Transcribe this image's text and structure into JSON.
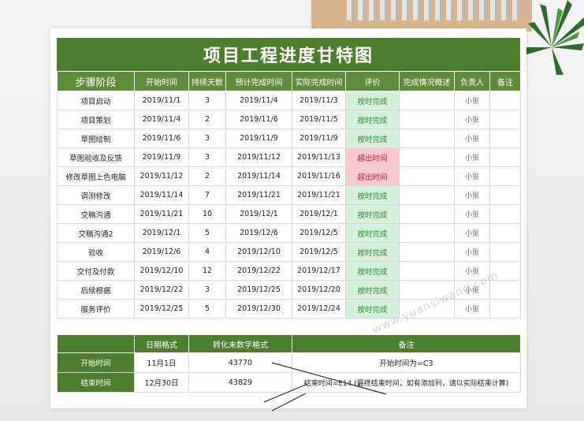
{
  "title": "项目工程进度甘特图",
  "headers": [
    "步骤阶段",
    "开始时间",
    "持续天数",
    "预计完成时间",
    "实际完成时间",
    "评价",
    "完成情况概述",
    "负责人",
    "备注"
  ],
  "rows": [
    {
      "step": "项目启动",
      "start": "2019/11/1",
      "days": "3",
      "planned": "2019/11/4",
      "actual": "2019/11/3",
      "eval": "按时完成",
      "status": "ok",
      "summary": "",
      "owner": "小张",
      "note": ""
    },
    {
      "step": "项目策划",
      "start": "2019/11/4",
      "days": "2",
      "planned": "2019/11/6",
      "actual": "2019/11/5",
      "eval": "按时完成",
      "status": "ok",
      "summary": "",
      "owner": "小张",
      "note": ""
    },
    {
      "step": "草图绘制",
      "start": "2019/11/6",
      "days": "3",
      "planned": "2019/11/9",
      "actual": "2019/11/9",
      "eval": "按时完成",
      "status": "ok",
      "summary": "",
      "owner": "小张",
      "note": ""
    },
    {
      "step": "草图验收及反馈",
      "start": "2019/11/9",
      "days": "3",
      "planned": "2019/11/12",
      "actual": "2019/11/13",
      "eval": "超出时间",
      "status": "late",
      "summary": "",
      "owner": "小张",
      "note": ""
    },
    {
      "step": "修改草图上色电脑",
      "start": "2019/11/12",
      "days": "2",
      "planned": "2019/11/14",
      "actual": "2019/11/16",
      "eval": "超出时间",
      "status": "late",
      "summary": "",
      "owner": "小张",
      "note": ""
    },
    {
      "step": "调测修改",
      "start": "2019/11/14",
      "days": "7",
      "planned": "2019/11/21",
      "actual": "2019/11/21",
      "eval": "按时完成",
      "status": "ok",
      "summary": "",
      "owner": "小张",
      "note": ""
    },
    {
      "step": "交稿沟通",
      "start": "2019/11/21",
      "days": "10",
      "planned": "2019/12/1",
      "actual": "2019/12/1",
      "eval": "按时完成",
      "status": "ok",
      "summary": "",
      "owner": "小张",
      "note": ""
    },
    {
      "step": "交稿沟通2",
      "start": "2019/12/1",
      "days": "5",
      "planned": "2019/12/6",
      "actual": "2019/12/5",
      "eval": "按时完成",
      "status": "ok",
      "summary": "",
      "owner": "小张",
      "note": ""
    },
    {
      "step": "验收",
      "start": "2019/12/6",
      "days": "4",
      "planned": "2019/12/10",
      "actual": "2019/12/5",
      "eval": "按时完成",
      "status": "ok",
      "summary": "",
      "owner": "小张",
      "note": ""
    },
    {
      "step": "交付及付款",
      "start": "2019/12/10",
      "days": "12",
      "planned": "2019/12/22",
      "actual": "2019/12/17",
      "eval": "按时完成",
      "status": "ok",
      "summary": "",
      "owner": "小张",
      "note": ""
    },
    {
      "step": "后续根据",
      "start": "2019/12/22",
      "days": "3",
      "planned": "2019/12/25",
      "actual": "2019/12/20",
      "eval": "按时完成",
      "status": "ok",
      "summary": "",
      "owner": "小张",
      "note": ""
    },
    {
      "step": "服务评价",
      "start": "2019/12/25",
      "days": "5",
      "planned": "2019/12/30",
      "actual": "2019/12/24",
      "eval": "按时完成",
      "status": "ok",
      "summary": "",
      "owner": "小张",
      "note": ""
    }
  ],
  "helper": {
    "headers": [
      "",
      "日期格式",
      "转化未数字格式",
      "备注"
    ],
    "rows": [
      {
        "label": "开始时间",
        "date": "11月1日",
        "num": "43770",
        "note": "开始时间为=C3"
      },
      {
        "label": "结束时间",
        "date": "12月30日",
        "num": "43829",
        "note": "结束时间=E14 (最终结束时间，如有添加列，请以实际结束计算)"
      }
    ]
  },
  "watermark": "www.yuansiwang.com",
  "colors": {
    "header_green": "#4d7e2f",
    "ok_bg": "#d3f2d9",
    "ok_text": "#2e8a3c",
    "late_bg": "#f9c9cf",
    "late_text": "#b0232f"
  }
}
